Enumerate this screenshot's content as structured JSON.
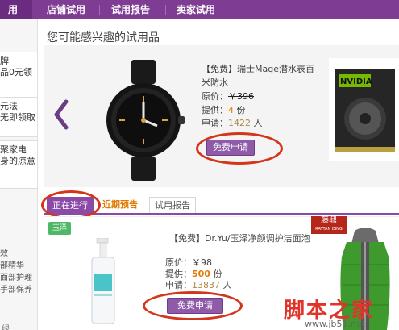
{
  "topnav": {
    "tabs": [
      "用",
      "店铺试用",
      "试用报告",
      "卖家试用"
    ]
  },
  "left": {
    "block1": [
      "牌",
      "品0元领"
    ],
    "block2": [
      "元法",
      "无即领取"
    ],
    "block3": [
      "聚家电",
      "身的凉意"
    ],
    "lower_items": [
      "效",
      "部精华",
      "面部护理",
      "手部保养"
    ],
    "bottom_note": "绿"
  },
  "section_title": "您可能感兴趣的试用品",
  "product1": {
    "free_tag": "【免费】",
    "name": "瑞士Mage潜水表百米防水",
    "price_label": "原价：",
    "price": "￥396",
    "supply_label": "提供：",
    "supply": "4",
    "supply_unit": "份",
    "apply_label": "申请：",
    "apply_count": "1422",
    "apply_unit": "人",
    "button": "免费申请"
  },
  "product2_tag": "NVIDIA",
  "tabs": {
    "active": "正在进行",
    "preview": "近期预告",
    "report": "试用报告"
  },
  "product3": {
    "logo": "玉泽",
    "free_tag": "【免费】",
    "name": "Dr.Yu/玉泽净颜调护洁面泡",
    "price_label": "原价：",
    "price": "￥98",
    "supply_label": "提供：",
    "supply": "500",
    "supply_unit": "份",
    "apply_label": "申请：",
    "apply_count": "13837",
    "apply_unit": "人",
    "button": "免费申请"
  },
  "product4": {
    "brand": "藤鼎",
    "brand_sub": "RATTAN DING"
  },
  "watermark": {
    "title": "脚本之家",
    "url": "www.jb51.net"
  },
  "colors": {
    "nav_bg": "#7e3d92",
    "button_bg": "#8f5aa8",
    "highlight_circle": "#d3361a",
    "accent_orange": "#e07a00"
  }
}
